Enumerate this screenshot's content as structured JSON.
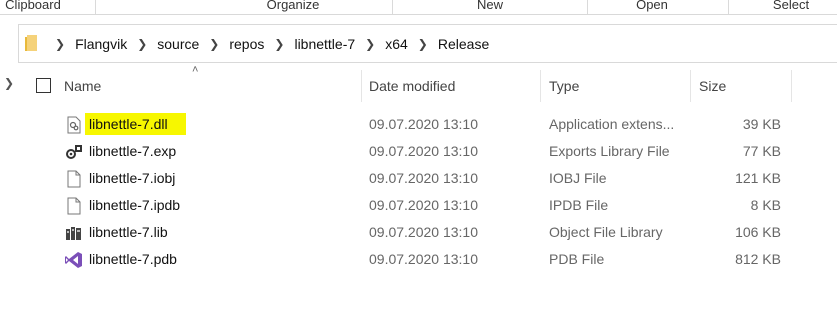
{
  "ribbon": {
    "groups": [
      "Clipboard",
      "Organize",
      "New",
      "Open",
      "Select"
    ]
  },
  "address_bar": {
    "breadcrumbs": [
      "Flangvik",
      "source",
      "repos",
      "libnettle-7",
      "x64",
      "Release"
    ]
  },
  "columns": {
    "name": "Name",
    "date": "Date modified",
    "type": "Type",
    "size": "Size"
  },
  "files": [
    {
      "name": "libnettle-7.dll",
      "date": "09.07.2020 13:10",
      "type": "Application extens...",
      "size": "39 KB",
      "icon": "dll-file-icon",
      "highlighted": true
    },
    {
      "name": "libnettle-7.exp",
      "date": "09.07.2020 13:10",
      "type": "Exports Library File",
      "size": "77 KB",
      "icon": "exp-file-icon"
    },
    {
      "name": "libnettle-7.iobj",
      "date": "09.07.2020 13:10",
      "type": "IOBJ File",
      "size": "121 KB",
      "icon": "blank-file-icon"
    },
    {
      "name": "libnettle-7.ipdb",
      "date": "09.07.2020 13:10",
      "type": "IPDB File",
      "size": "8 KB",
      "icon": "blank-file-icon"
    },
    {
      "name": "libnettle-7.lib",
      "date": "09.07.2020 13:10",
      "type": "Object File Library",
      "size": "106 KB",
      "icon": "lib-file-icon"
    },
    {
      "name": "libnettle-7.pdb",
      "date": "09.07.2020 13:10",
      "type": "PDB File",
      "size": "812 KB",
      "icon": "visual-studio-pdb-icon"
    }
  ],
  "colors": {
    "highlight": "#f7f700",
    "folder": "#e8b93a",
    "vs_purple": "#7b4fb8"
  }
}
